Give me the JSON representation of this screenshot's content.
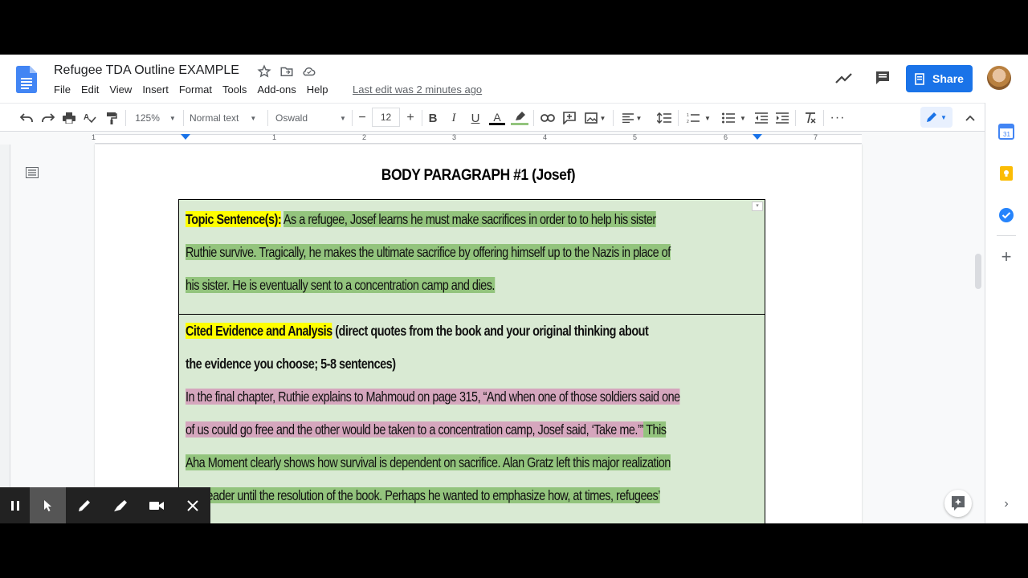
{
  "header": {
    "title": "Refugee TDA Outline EXAMPLE",
    "menu": [
      "File",
      "Edit",
      "View",
      "Insert",
      "Format",
      "Tools",
      "Add-ons",
      "Help"
    ],
    "last_edit": "Last edit was 2 minutes ago",
    "share_label": "Share"
  },
  "toolbar": {
    "zoom": "125%",
    "style": "Normal text",
    "font": "Oswald",
    "font_size": "12"
  },
  "ruler": {
    "numbers": [
      "1",
      "1",
      "2",
      "3",
      "4",
      "5",
      "6",
      "7"
    ]
  },
  "document": {
    "heading": "BODY PARAGRAPH #1 (Josef)",
    "cell1": {
      "label": "Topic Sentence(s):",
      "line1": "As a refugee, Josef learns he must make sacrifices in order to to help his sister",
      "line2": "Ruthie survive. Tragically, he makes the ultimate sacrifice by offering himself up to the Nazis in place of",
      "line3": "his sister. He is eventually sent to a concentration camp and dies."
    },
    "cell2": {
      "label": "Cited Evidence and Analysis",
      "instr1": " (direct quotes from the book and your original thinking about",
      "instr2": "the evidence you choose; 5-8 sentences)",
      "quote1": "In the final chapter, Ruthie explains to Mahmoud on page 315, “And when one of those soldiers said one",
      "quote2": "of us could go free and the other would be taken to a concentration camp, Josef said, ‘Take me.’”",
      "analysis2": " This",
      "analysis3": "Aha Moment clearly shows how survival is dependent on sacrifice. Alan Gratz left this major realization",
      "analysis4": "the reader until the resolution of the book. Perhaps he wanted to emphasize how, at times, refugees’"
    }
  },
  "colors": {
    "accent": "#1a73e8",
    "cell_bg": "#d9ead3",
    "highlight_yellow": "#ffff00",
    "highlight_green": "#93c47d",
    "highlight_pink": "#d5a6bd"
  }
}
